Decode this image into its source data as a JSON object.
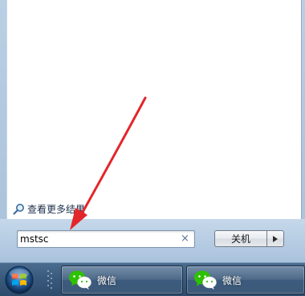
{
  "start_menu": {
    "more_results_label": "查看更多结果",
    "search": {
      "value": "mstsc",
      "clear_symbol": "×"
    },
    "shutdown": {
      "label": "关机"
    }
  },
  "taskbar": {
    "items": [
      {
        "label": "微信",
        "icon": "wechat-icon"
      },
      {
        "label": "微信",
        "icon": "wechat-icon"
      }
    ]
  },
  "colors": {
    "annotation_arrow": "#e3262b",
    "wechat_green": "#2dc100"
  }
}
